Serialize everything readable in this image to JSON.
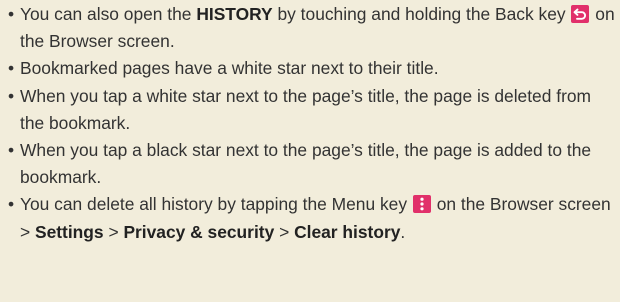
{
  "notes": {
    "bullets": [
      {
        "parts": [
          "You can also open the ",
          "HISTORY",
          " by touching and holding the Back key ",
          " on the Browser screen."
        ],
        "icon": "back-key-icon"
      },
      {
        "text": "Bookmarked pages have a white star next to their title."
      },
      {
        "text": "When you tap a white star next to the page’s title, the page is deleted from the bookmark."
      },
      {
        "text": "When you tap a black star next to the page’s title, the page is added to the bookmark."
      },
      {
        "parts": [
          "You can delete all history by tapping the Menu key ",
          " on the Browser screen > ",
          "Settings",
          " > ",
          "Privacy & security",
          " > ",
          "Clear history",
          "."
        ],
        "icon": "menu-key-icon"
      }
    ]
  },
  "colors": {
    "background": "#f2eddb",
    "text": "#333333",
    "key_icon": "#e1306a"
  }
}
